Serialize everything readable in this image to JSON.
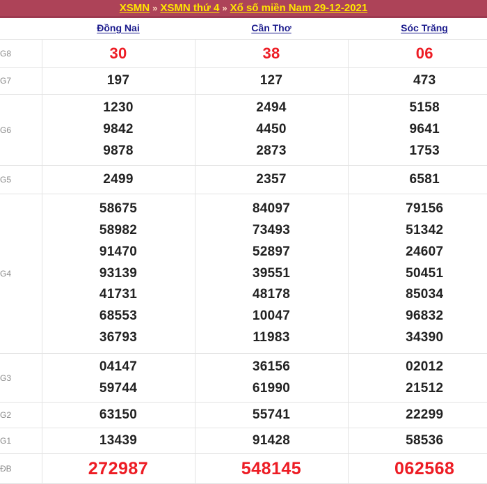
{
  "breadcrumb": {
    "separator": "»",
    "items": [
      {
        "label": "XSMN"
      },
      {
        "label": "XSMN thứ 4"
      },
      {
        "label": "Xổ số miền Nam 29-12-2021"
      }
    ]
  },
  "table": {
    "corner_label": "",
    "provinces": [
      {
        "name": "Đồng Nai"
      },
      {
        "name": "Cần Thơ"
      },
      {
        "name": "Sóc Trăng"
      }
    ],
    "rows": [
      {
        "label": "G8",
        "cells": [
          [
            "30"
          ],
          [
            "38"
          ],
          [
            "06"
          ]
        ]
      },
      {
        "label": "G7",
        "cells": [
          [
            "197"
          ],
          [
            "127"
          ],
          [
            "473"
          ]
        ]
      },
      {
        "label": "G6",
        "cells": [
          [
            "1230",
            "9842",
            "9878"
          ],
          [
            "2494",
            "4450",
            "2873"
          ],
          [
            "5158",
            "9641",
            "1753"
          ]
        ]
      },
      {
        "label": "G5",
        "cells": [
          [
            "2499"
          ],
          [
            "2357"
          ],
          [
            "6581"
          ]
        ]
      },
      {
        "label": "G4",
        "cells": [
          [
            "58675",
            "58982",
            "91470",
            "93139",
            "41731",
            "68553",
            "36793"
          ],
          [
            "84097",
            "73493",
            "52897",
            "39551",
            "48178",
            "10047",
            "11983"
          ],
          [
            "79156",
            "51342",
            "24607",
            "50451",
            "85034",
            "96832",
            "34390"
          ]
        ]
      },
      {
        "label": "G3",
        "cells": [
          [
            "04147",
            "59744"
          ],
          [
            "36156",
            "61990"
          ],
          [
            "02012",
            "21512"
          ]
        ]
      },
      {
        "label": "G2",
        "cells": [
          [
            "63150"
          ],
          [
            "55741"
          ],
          [
            "22299"
          ]
        ]
      },
      {
        "label": "G1",
        "cells": [
          [
            "13439"
          ],
          [
            "91428"
          ],
          [
            "58536"
          ]
        ]
      },
      {
        "label": "ĐB",
        "cells": [
          [
            "272987"
          ],
          [
            "548145"
          ],
          [
            "062568"
          ]
        ]
      }
    ]
  },
  "colors": {
    "header_bg": "#ad4358",
    "header_link": "#ffe600",
    "province_link": "#1a1a8c",
    "highlight_number": "#ed1c24",
    "normal_number": "#222222",
    "label_text": "#8a8a8a",
    "grid_line": "#e3e3e3"
  }
}
